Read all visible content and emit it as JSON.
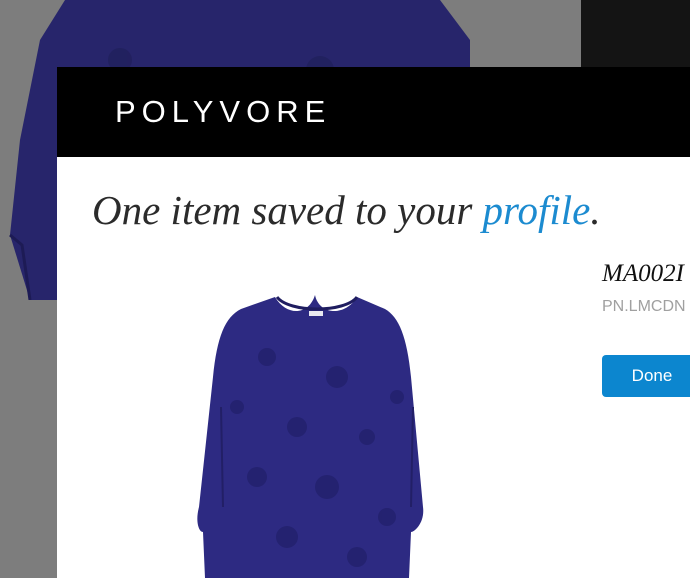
{
  "brand": {
    "logo_text": "POLYVORE"
  },
  "headline": {
    "prefix": "One item saved to your ",
    "link": "profile",
    "suffix": "."
  },
  "item": {
    "title": "MA002I",
    "source": "PN.LMCDN"
  },
  "actions": {
    "done_label": "Done"
  },
  "colors": {
    "header_bg": "#000000",
    "link": "#1c8bd0",
    "button": "#0c86cf",
    "dress": "#27256b"
  },
  "icons": {
    "product": "navy-dress-image"
  }
}
